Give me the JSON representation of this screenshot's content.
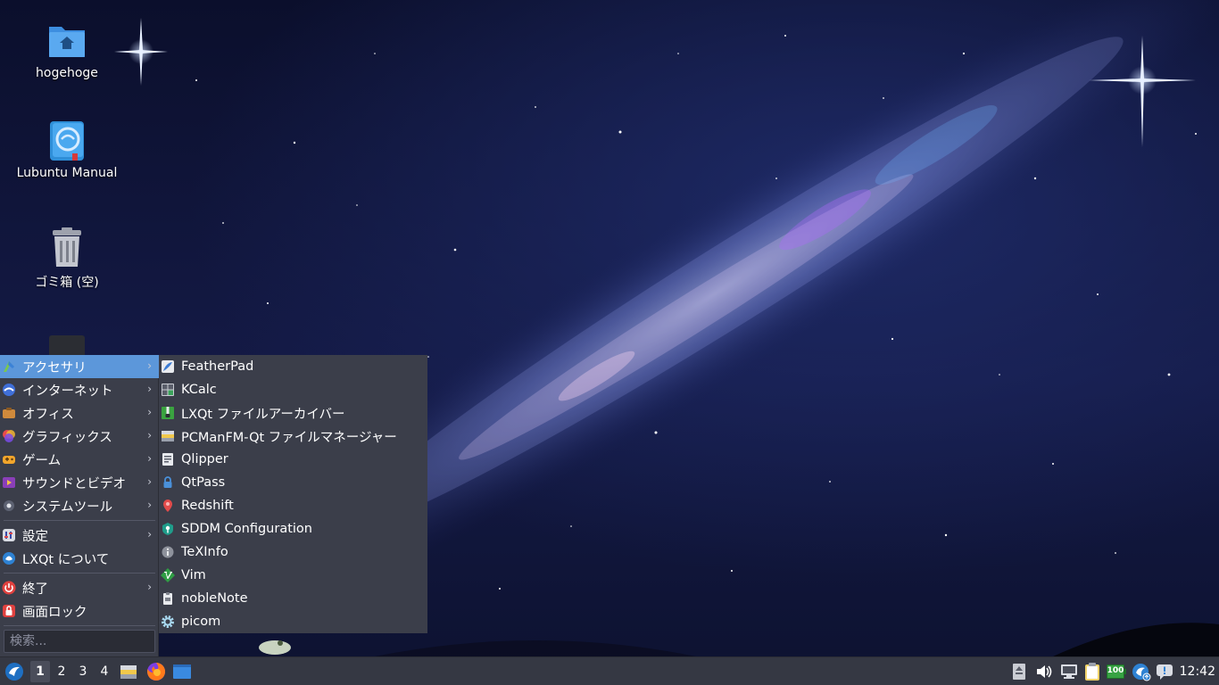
{
  "desktop": {
    "icons": [
      {
        "label": "hogehoge",
        "icon": "home-folder-icon"
      },
      {
        "label": "Lubuntu Manual",
        "icon": "manual-book-icon"
      },
      {
        "label": "ゴミ箱 (空)",
        "icon": "trash-icon"
      }
    ]
  },
  "main_menu": {
    "items": [
      {
        "label": "アクセサリ",
        "icon": "accessories-icon",
        "has_submenu": true,
        "active": true
      },
      {
        "label": "インターネット",
        "icon": "internet-icon",
        "has_submenu": true
      },
      {
        "label": "オフィス",
        "icon": "office-icon",
        "has_submenu": true
      },
      {
        "label": "グラフィックス",
        "icon": "graphics-icon",
        "has_submenu": true
      },
      {
        "label": "ゲーム",
        "icon": "games-icon",
        "has_submenu": true
      },
      {
        "label": "サウンドとビデオ",
        "icon": "multimedia-icon",
        "has_submenu": true
      },
      {
        "label": "システムツール",
        "icon": "system-tools-icon",
        "has_submenu": true
      },
      {
        "label": "設定",
        "icon": "settings-icon",
        "has_submenu": true
      },
      {
        "label": "LXQt について",
        "icon": "lxqt-about-icon",
        "has_submenu": false
      },
      {
        "label": "終了",
        "icon": "power-icon",
        "has_submenu": true
      },
      {
        "label": "画面ロック",
        "icon": "lock-icon",
        "has_submenu": false
      }
    ],
    "search_placeholder": "検索..."
  },
  "sub_menu": {
    "items": [
      {
        "label": "FeatherPad",
        "icon": "featherpad-icon"
      },
      {
        "label": "KCalc",
        "icon": "calculator-icon"
      },
      {
        "label": "LXQt ファイルアーカイバー",
        "icon": "archiver-icon"
      },
      {
        "label": "PCManFM-Qt ファイルマネージャー",
        "icon": "file-manager-icon"
      },
      {
        "label": "Qlipper",
        "icon": "clipboard-icon"
      },
      {
        "label": "QtPass",
        "icon": "password-icon"
      },
      {
        "label": "Redshift",
        "icon": "redshift-icon"
      },
      {
        "label": "SDDM Configuration",
        "icon": "sddm-icon"
      },
      {
        "label": "TeXInfo",
        "icon": "info-icon"
      },
      {
        "label": "Vim",
        "icon": "vim-icon"
      },
      {
        "label": "nobleNote",
        "icon": "note-icon"
      },
      {
        "label": "picom",
        "icon": "gear-icon"
      }
    ]
  },
  "taskbar": {
    "desktops": [
      "1",
      "2",
      "3",
      "4"
    ],
    "current_desktop": "1",
    "quicklaunch": [
      "file-manager-icon",
      "firefox-icon",
      "show-desktop-icon"
    ],
    "tray": [
      "eject-icon",
      "volume-icon",
      "network-icon",
      "clipboard-icon",
      "battery-icon",
      "update-icon",
      "notification-icon"
    ],
    "battery_label": "100",
    "clock": "12:42"
  },
  "colors": {
    "menu_bg": "#3b3e4a",
    "menu_highlight": "#5c97da",
    "taskbar_bg": "#353843"
  }
}
